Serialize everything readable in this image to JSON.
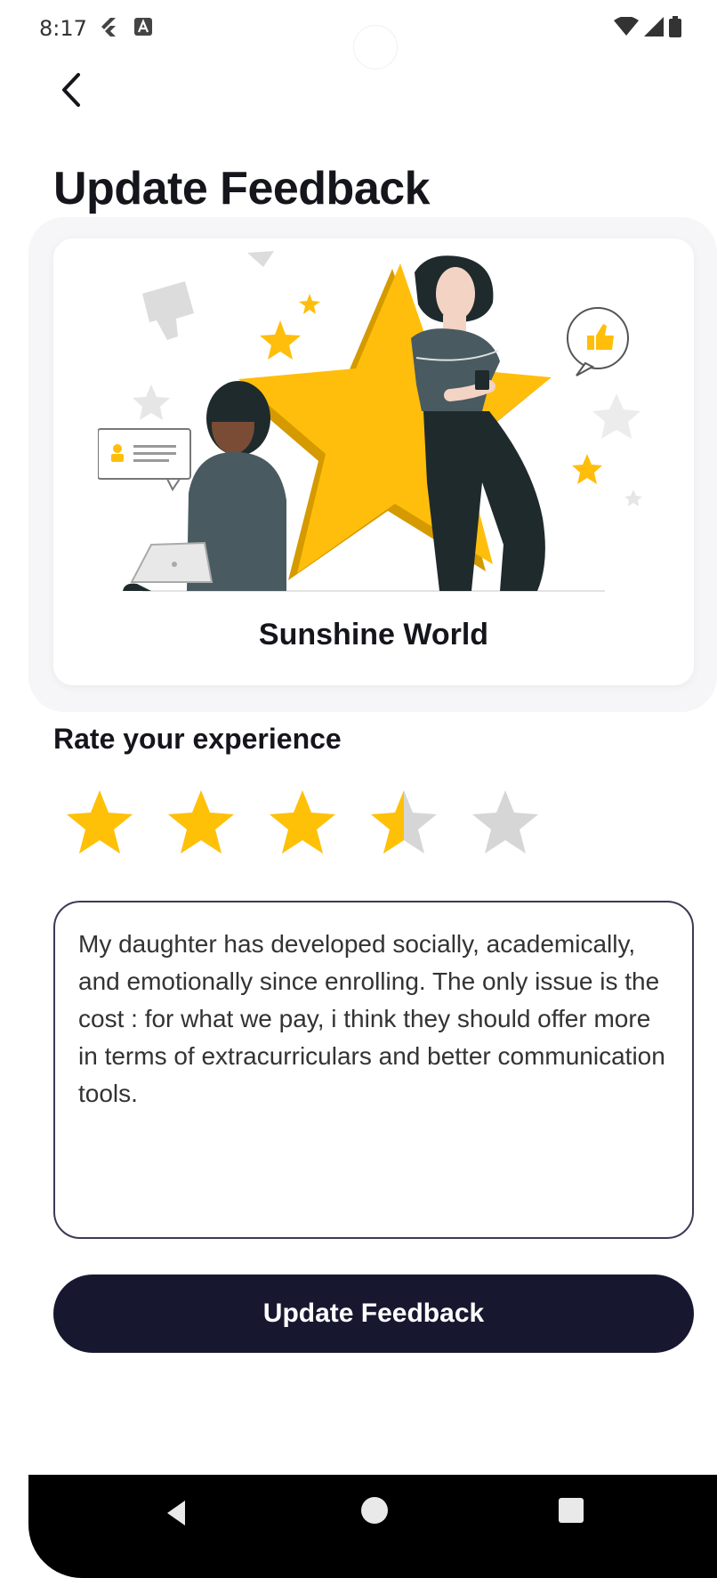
{
  "status_bar": {
    "time": "8:17",
    "left_icons": [
      "flutter-icon",
      "a-badge-icon"
    ],
    "right_icons": [
      "wifi-icon",
      "signal-icon",
      "battery-icon"
    ]
  },
  "header": {
    "back_icon": "chevron-left-icon",
    "title": "Update Feedback"
  },
  "card": {
    "illustration": "rating-illustration",
    "school_name": "Sunshine World"
  },
  "rating": {
    "label": "Rate your experience",
    "value": 3.5,
    "max": 5,
    "filled_color": "#FFC107",
    "empty_color": "#D6D6D6"
  },
  "feedback": {
    "text": "My daughter has developed socially, academically, and emotionally since enrolling. The only issue is the cost : for what we pay, i think they should offer more in terms of extracurriculars and better communication tools."
  },
  "actions": {
    "submit_label": "Update Feedback",
    "button_color": "#171830"
  },
  "nav_bar": {
    "icons": [
      "nav-back-icon",
      "nav-home-icon",
      "nav-recents-icon"
    ]
  }
}
